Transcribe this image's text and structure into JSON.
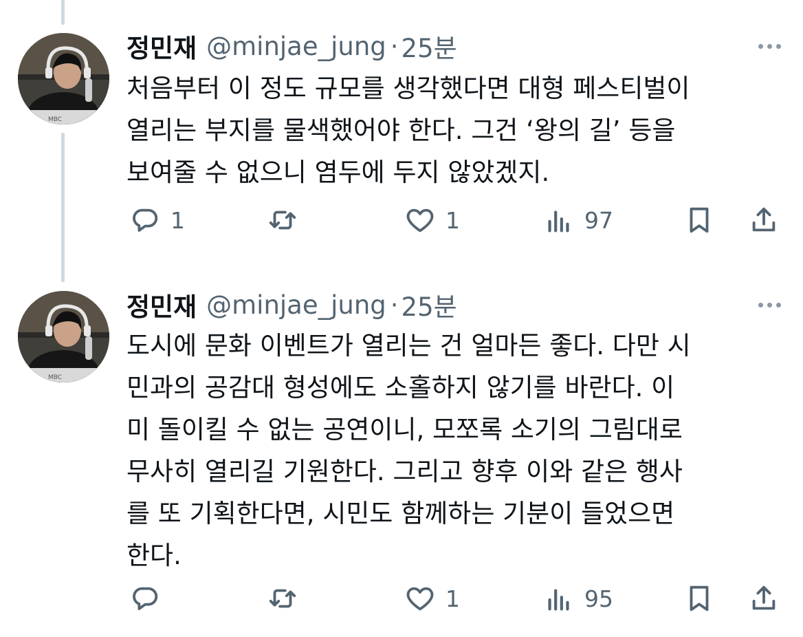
{
  "tweets": [
    {
      "name": "정민재",
      "handle": "@minjae_jung",
      "separator": "·",
      "time": "25분",
      "lines": [
        "처음부터 이 정도 규모를 생각했다면 대형 페스티벌이",
        "열리는 부지를 물색했어야 한다. 그건 ‘왕의 길’ 등을",
        "보여줄 수 없으니 염두에 두지 않았겠지."
      ],
      "replies": "1",
      "likes": "1",
      "views": "97",
      "avatar_caption": "MBC"
    },
    {
      "name": "정민재",
      "handle": "@minjae_jung",
      "separator": "·",
      "time": "25분",
      "lines": [
        "도시에 문화 이벤트가 열리는 건 얼마든 좋다. 다만 시",
        "민과의 공감대 형성에도 소홀하지 않기를 바란다. 이",
        "미 돌이킬 수 없는 공연이니, 모쪼록 소기의 그림대로",
        "무사히 열리길 기원한다. 그리고 향후 이와 같은 행사",
        "를 또 기획한다면, 시민도 함께하는 기분이 들었으면",
        "한다."
      ],
      "replies": "",
      "likes": "1",
      "views": "95",
      "avatar_caption": "MBC"
    }
  ],
  "icons": {
    "reply": "reply-icon",
    "retweet": "retweet-icon",
    "like": "heart-icon",
    "views": "views-icon",
    "bookmark": "bookmark-icon",
    "share": "share-icon",
    "more": "more-icon"
  },
  "colors": {
    "text": "#0f1419",
    "muted": "#536471",
    "thread_line": "#cfd9de"
  }
}
